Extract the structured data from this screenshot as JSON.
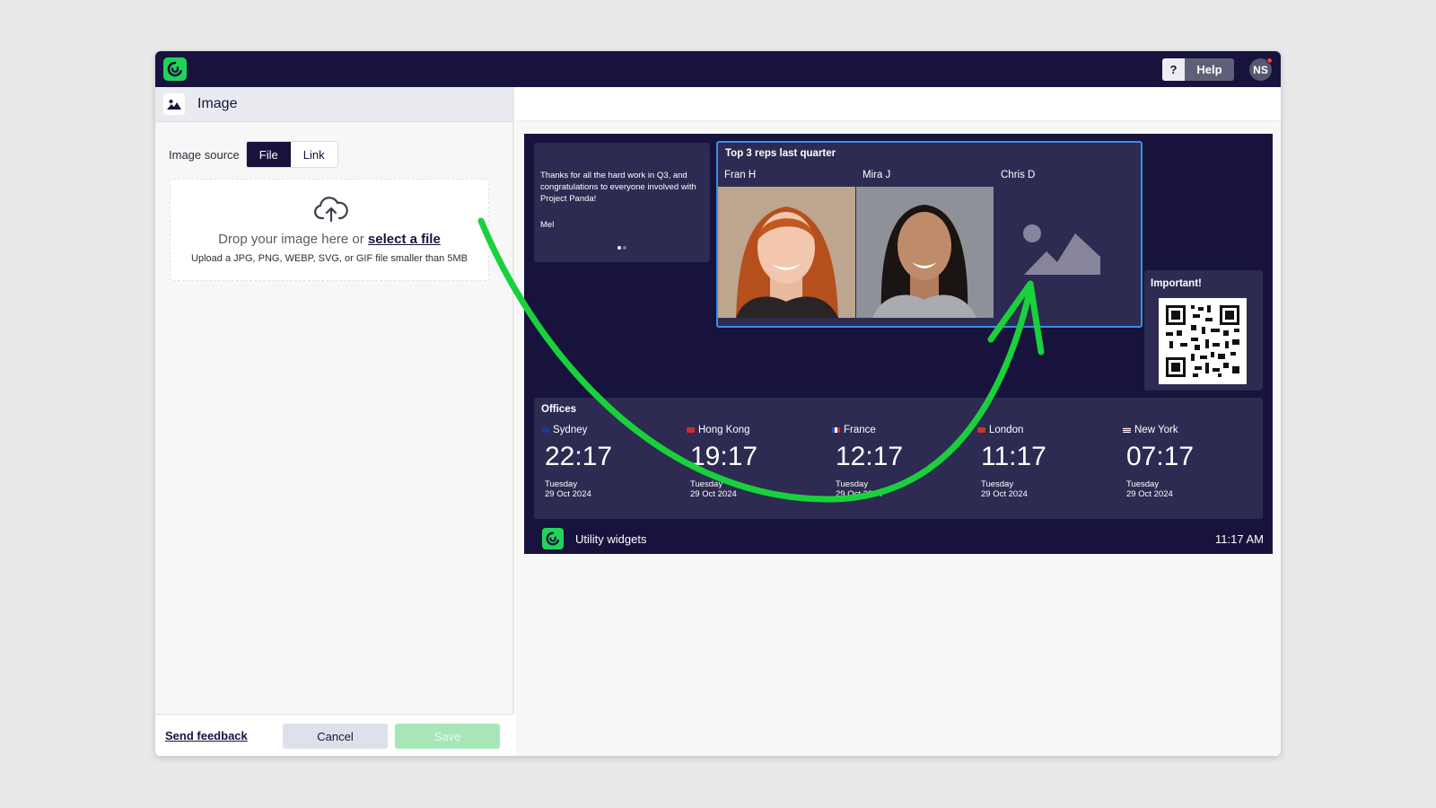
{
  "topbar": {
    "help_q": "?",
    "help_label": "Help",
    "avatar_initials": "NS"
  },
  "panel": {
    "title": "Image",
    "source_label": "Image source",
    "source_options": [
      "File",
      "Link"
    ],
    "selected_source": "File",
    "drop_text": "Drop your image here or",
    "drop_link": "select a file",
    "drop_hint": "Upload a JPG, PNG, WEBP, SVG, or GIF file smaller than 5MB"
  },
  "footer": {
    "feedback": "Send feedback",
    "cancel": "Cancel",
    "save": "Save"
  },
  "preview": {
    "message": {
      "text": "Thanks for all the hard work in Q3, and congratulations to everyone involved with Project Panda!",
      "author": "Mel"
    },
    "reps": {
      "title": "Top 3 reps last quarter",
      "people": [
        "Fran H",
        "Mira J",
        "Chris D"
      ]
    },
    "important": {
      "title": "Important!"
    },
    "offices": {
      "title": "Offices",
      "cities": [
        {
          "name": "Sydney",
          "time": "22:17",
          "day": "Tuesday",
          "date": "29 Oct 2024",
          "flag_color": "#1f3a8a"
        },
        {
          "name": "Hong Kong",
          "time": "19:17",
          "day": "Tuesday",
          "date": "29 Oct 2024",
          "flag_color": "#d22b2b"
        },
        {
          "name": "France",
          "time": "12:17",
          "day": "Tuesday",
          "date": "29 Oct 2024",
          "flag_color": "#2b4fc2"
        },
        {
          "name": "London",
          "time": "11:17",
          "day": "Tuesday",
          "date": "29 Oct 2024",
          "flag_color": "#c0392b"
        },
        {
          "name": "New York",
          "time": "07:17",
          "day": "Tuesday",
          "date": "29 Oct 2024",
          "flag_color": "#b22234"
        }
      ]
    },
    "footer": {
      "name": "Utility widgets",
      "time": "11:17 AM"
    }
  },
  "colors": {
    "brand_green": "#22d35a",
    "navy": "#17133d",
    "card": "#2d2b52",
    "selection": "#3b8de6",
    "arrow": "#19d23b"
  }
}
